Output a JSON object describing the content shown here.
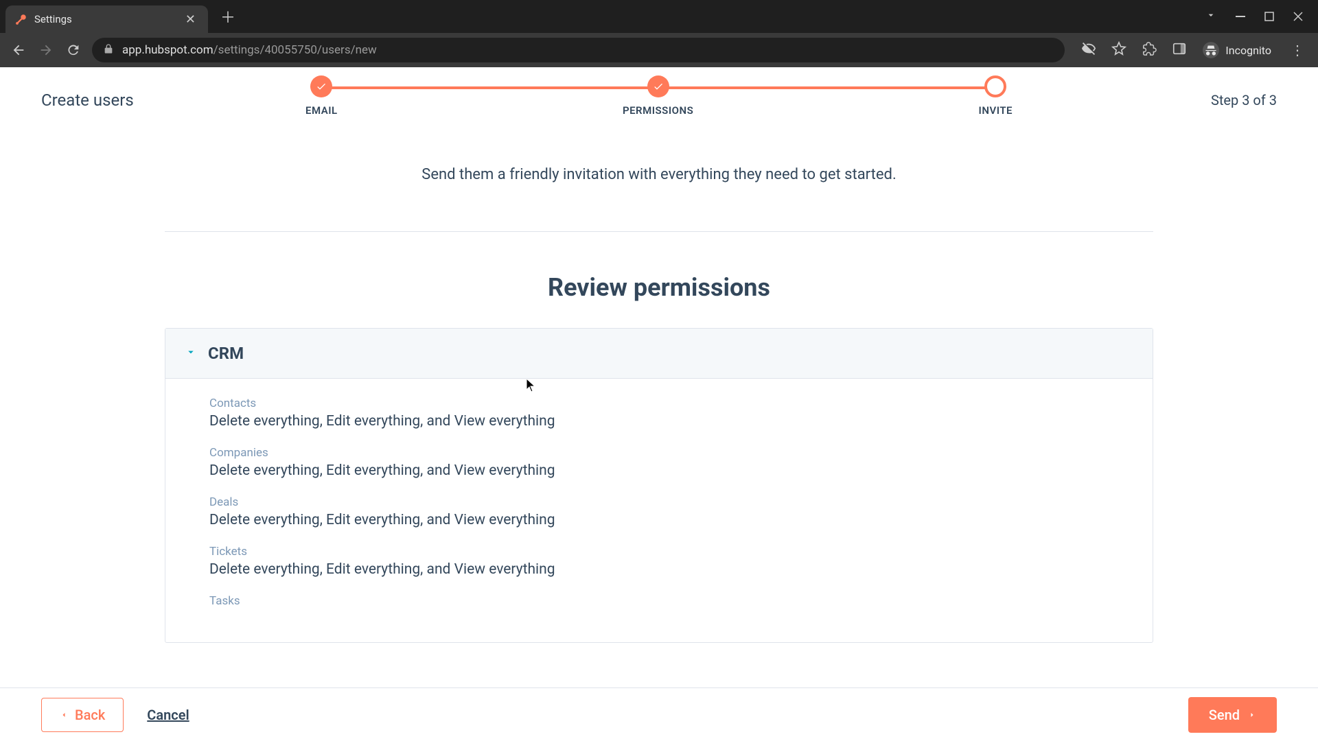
{
  "browser": {
    "tab_title": "Settings",
    "url_host": "app.hubspot.com",
    "url_path": "/settings/40055750/users/new",
    "incognito_label": "Incognito"
  },
  "header": {
    "title": "Create users",
    "step_indicator": "Step 3 of 3"
  },
  "stepper": {
    "steps": [
      {
        "label": "EMAIL",
        "state": "done"
      },
      {
        "label": "PERMISSIONS",
        "state": "done"
      },
      {
        "label": "INVITE",
        "state": "current"
      }
    ]
  },
  "main": {
    "subtitle": "Send them a friendly invitation with everything they need to get started.",
    "review_title": "Review permissions",
    "sections": [
      {
        "title": "CRM",
        "expanded": true,
        "items": [
          {
            "label": "Contacts",
            "value": "Delete everything, Edit everything, and View everything"
          },
          {
            "label": "Companies",
            "value": "Delete everything, Edit everything, and View everything"
          },
          {
            "label": "Deals",
            "value": "Delete everything, Edit everything, and View everything"
          },
          {
            "label": "Tickets",
            "value": "Delete everything, Edit everything, and View everything"
          },
          {
            "label": "Tasks",
            "value": ""
          }
        ]
      }
    ]
  },
  "footer": {
    "back_label": "Back",
    "cancel_label": "Cancel",
    "send_label": "Send"
  }
}
